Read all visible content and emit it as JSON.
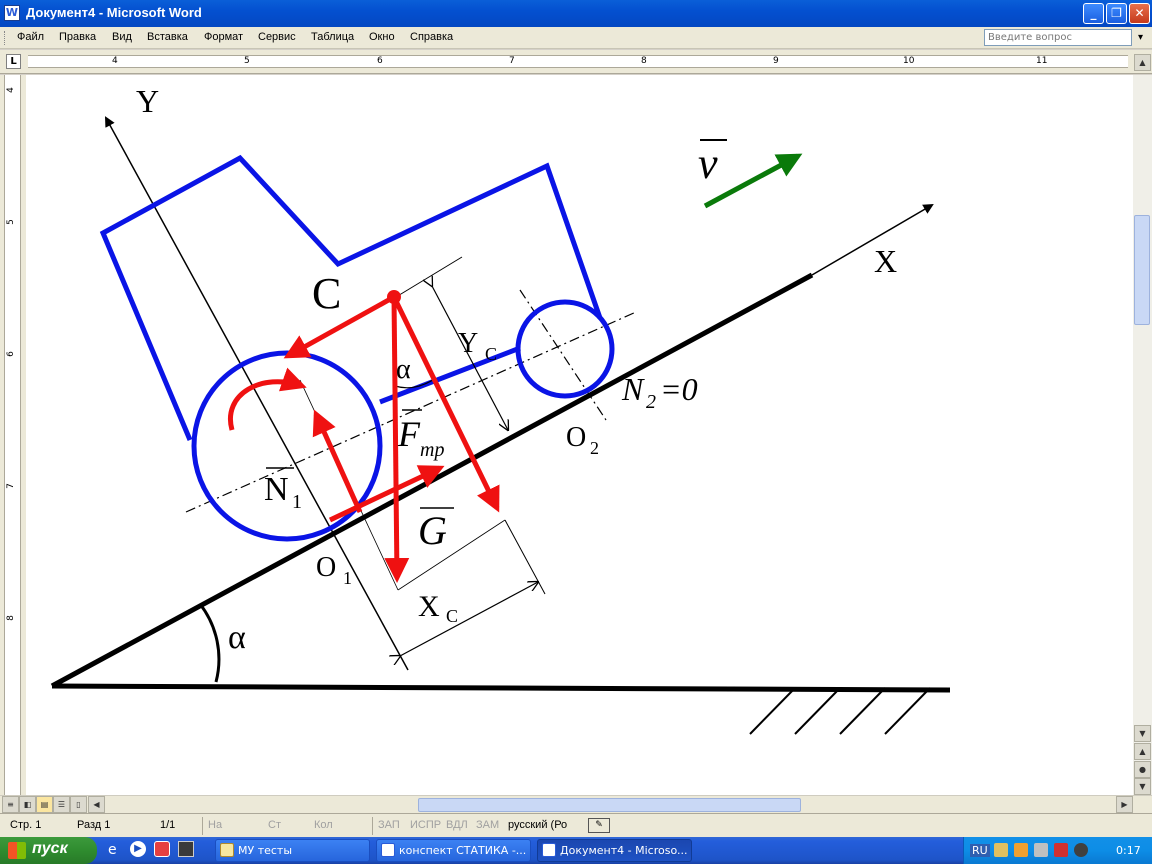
{
  "window": {
    "title": "Документ4 - Microsoft Word",
    "app_icon": "W",
    "controls": {
      "minimize": "_",
      "restore": "❐",
      "close": "✕"
    }
  },
  "menu": {
    "items": [
      "Файл",
      "Правка",
      "Вид",
      "Вставка",
      "Формат",
      "Сервис",
      "Таблица",
      "Окно",
      "Справка"
    ],
    "ask_placeholder": "Введите вопрос",
    "close_glyph": "✕"
  },
  "ruler": {
    "tab_glyph": "L",
    "numbers": [
      "4",
      "5",
      "6",
      "7",
      "8",
      "9",
      "10",
      "11"
    ],
    "vertical_numbers": [
      "4",
      "5",
      "6",
      "7",
      "8"
    ]
  },
  "diagram": {
    "label_y": "Y",
    "label_x": "X",
    "label_c": "C",
    "label_v": "v",
    "label_yc": "Y",
    "label_yc_sub": "C",
    "label_alpha_top": "α",
    "label_ftr": "F",
    "label_ftr_sub": "тр",
    "label_n2": "N",
    "label_n2_sub": "2",
    "label_n2_eq": "=0",
    "label_o2": "O",
    "label_o2_sub": "2",
    "label_n1": "N",
    "label_n1_sub": "1",
    "label_g": "G",
    "label_o1": "O",
    "label_o1_sub": "1",
    "label_xc": "X",
    "label_xc_sub": "C",
    "label_alpha_bottom": "α",
    "colors": {
      "body": "#0a14e6",
      "force": "#ef1111",
      "velocity": "#0a7a0a",
      "ground": "#000000"
    }
  },
  "status": {
    "page": "Стр. 1",
    "section": "Разд 1",
    "pages": "1/1",
    "at": "На",
    "line": "Ст",
    "col": "Кол",
    "rec": "ЗАП",
    "trk": "ИСПР",
    "ext": "ВДЛ",
    "ovr": "ЗАМ",
    "language": "русский (Ро"
  },
  "taskbar": {
    "start_label": "пуск",
    "tasks": [
      "МУ тесты",
      "конспект СТАТИКА -...",
      "Документ4 - Microso..."
    ],
    "lang": "RU",
    "clock": "0:17"
  }
}
